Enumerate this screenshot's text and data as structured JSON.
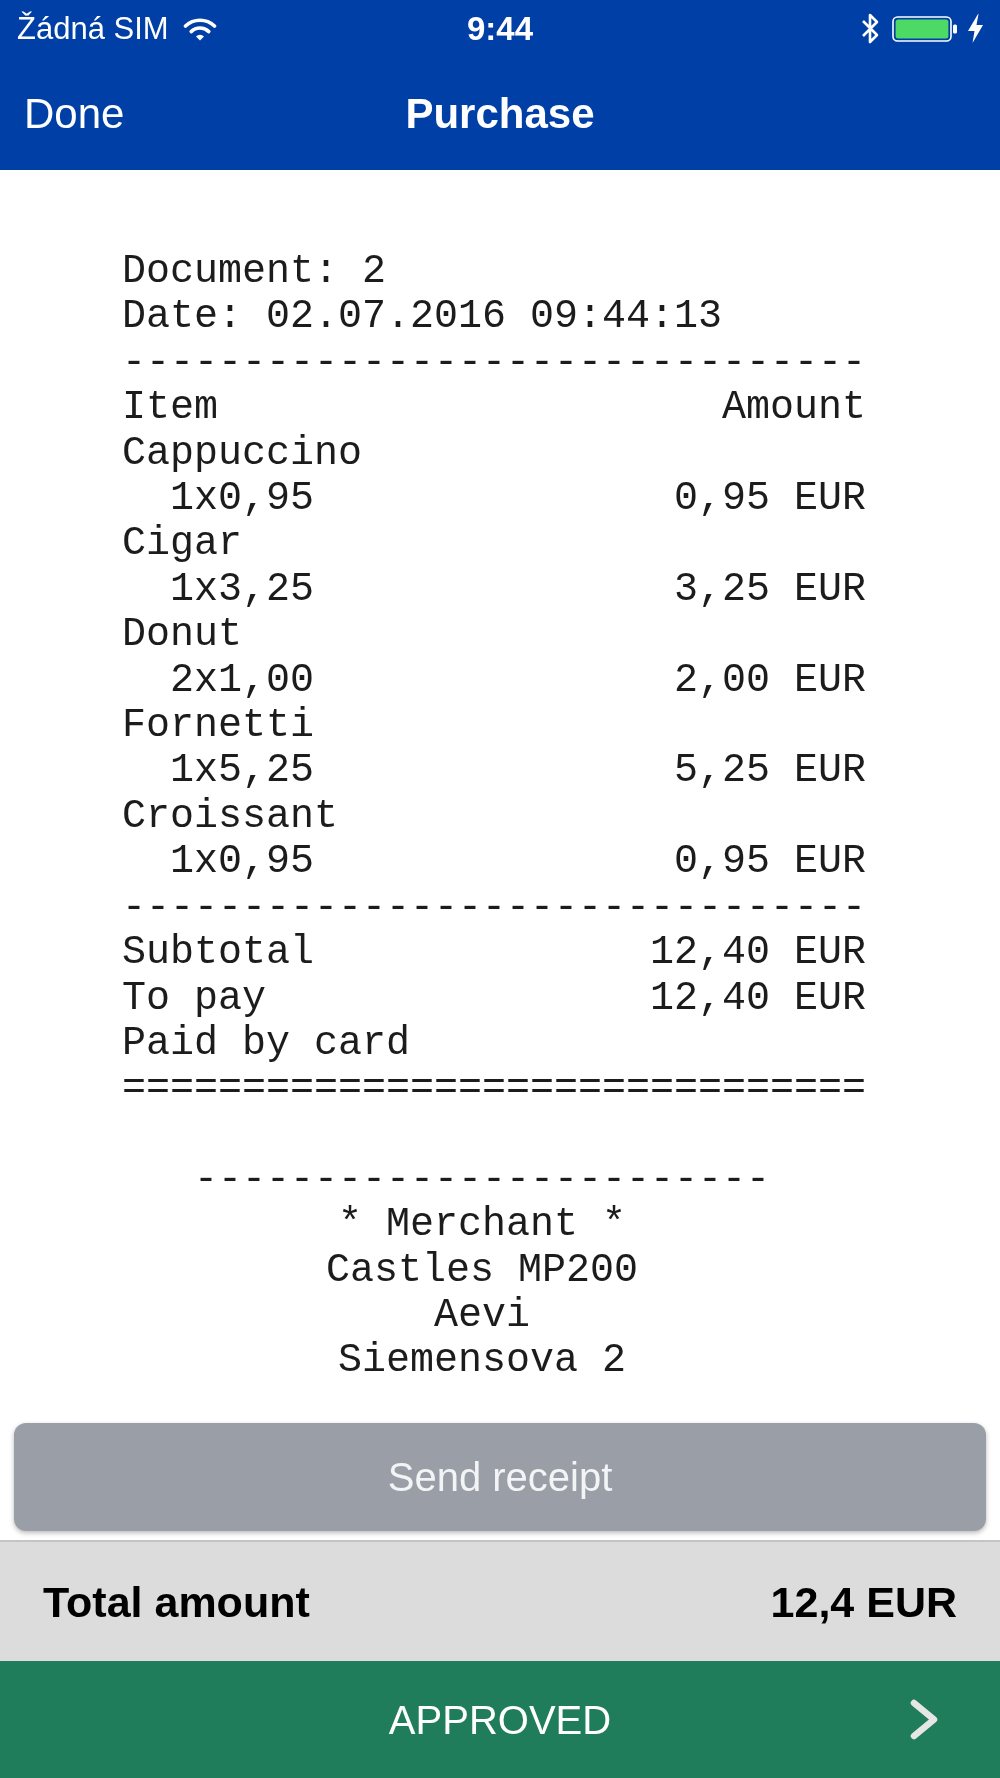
{
  "status_bar": {
    "carrier": "Žádná SIM",
    "time": "9:44"
  },
  "nav_bar": {
    "left_button": "Done",
    "title": "Purchase"
  },
  "receipt": {
    "lines": [
      {
        "kind": "text",
        "text": "Document: 2"
      },
      {
        "kind": "text",
        "text": "Date: 02.07.2016 09:44:13"
      },
      {
        "kind": "rule",
        "text": "-------------------------------"
      },
      {
        "kind": "pair",
        "label": "Item",
        "value": "Amount"
      },
      {
        "kind": "item",
        "name": "Cappuccino",
        "quantity": "1x0,95",
        "amount": "0,95 EUR"
      },
      {
        "kind": "item",
        "name": "Cigar",
        "quantity": "1x3,25",
        "amount": "3,25 EUR"
      },
      {
        "kind": "item",
        "name": "Donut",
        "quantity": "2x1,00",
        "amount": "2,00 EUR"
      },
      {
        "kind": "item",
        "name": "Fornetti",
        "quantity": "1x5,25",
        "amount": "5,25 EUR"
      },
      {
        "kind": "item",
        "name": "Croissant",
        "quantity": "1x0,95",
        "amount": "0,95 EUR"
      },
      {
        "kind": "rule",
        "text": "-------------------------------"
      },
      {
        "kind": "pair",
        "label": "Subtotal",
        "value": "12,40 EUR"
      },
      {
        "kind": "pair",
        "label": "To pay",
        "value": "12,40 EUR"
      },
      {
        "kind": "text",
        "text": "Paid by card"
      },
      {
        "kind": "rule",
        "text": "==============================="
      }
    ],
    "footer": {
      "separator": "------------------------",
      "lines": [
        "* Merchant *",
        "Castles MP200",
        "Aevi",
        "Siemensova 2"
      ]
    }
  },
  "send_button": {
    "label": "Send receipt",
    "disabled": true
  },
  "total": {
    "label": "Total amount",
    "value": "12,4 EUR"
  },
  "status_row": {
    "label": "APPROVED"
  }
}
